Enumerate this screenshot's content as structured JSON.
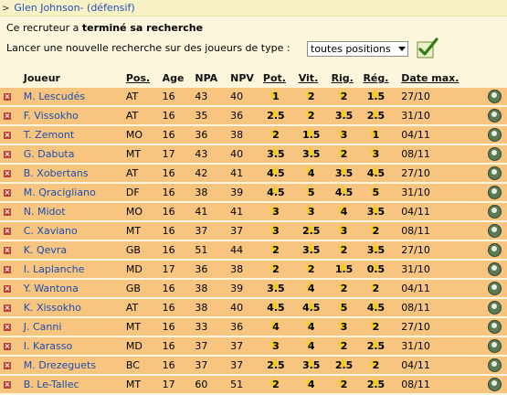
{
  "header": {
    "arrow": ">",
    "title": "Glen Johnson- (défensif)"
  },
  "status": {
    "prefix": "Ce recruteur a ",
    "bold": "terminé sa recherche"
  },
  "search": {
    "label": "Lancer une nouvelle recherche sur des joueurs de type :",
    "selected": "toutes positions"
  },
  "columns": [
    "Joueur",
    "Pos.",
    "Age",
    "NPA",
    "NPV",
    "Pot.",
    "Vit.",
    "Rig.",
    "Rég.",
    "Date max."
  ],
  "players": [
    {
      "name": "M. Lescudés",
      "pos": "AT",
      "age": "16",
      "npa": "43",
      "npv": "40",
      "pot": "1",
      "vit": "2",
      "rig": "2",
      "reg": "1.5",
      "date": "27/10"
    },
    {
      "name": "F. Vissokho",
      "pos": "AT",
      "age": "16",
      "npa": "35",
      "npv": "36",
      "pot": "2.5",
      "vit": "2",
      "rig": "3.5",
      "reg": "2.5",
      "date": "31/10"
    },
    {
      "name": "T. Zemont",
      "pos": "MO",
      "age": "16",
      "npa": "36",
      "npv": "38",
      "pot": "2",
      "vit": "1.5",
      "rig": "3",
      "reg": "1",
      "date": "04/11"
    },
    {
      "name": "G. Dabuta",
      "pos": "MT",
      "age": "17",
      "npa": "43",
      "npv": "40",
      "pot": "3.5",
      "vit": "3.5",
      "rig": "2",
      "reg": "3",
      "date": "08/11"
    },
    {
      "name": "B. Xobertans",
      "pos": "AT",
      "age": "16",
      "npa": "42",
      "npv": "41",
      "pot": "4.5",
      "vit": "4",
      "rig": "3.5",
      "reg": "4.5",
      "date": "27/10"
    },
    {
      "name": "M. Qracigliano",
      "pos": "DF",
      "age": "16",
      "npa": "38",
      "npv": "39",
      "pot": "4.5",
      "vit": "5",
      "rig": "4.5",
      "reg": "5",
      "date": "31/10"
    },
    {
      "name": "N. Midot",
      "pos": "MO",
      "age": "16",
      "npa": "41",
      "npv": "41",
      "pot": "3",
      "vit": "3",
      "rig": "4",
      "reg": "3.5",
      "date": "04/11"
    },
    {
      "name": "C. Xaviano",
      "pos": "MT",
      "age": "16",
      "npa": "37",
      "npv": "37",
      "pot": "3",
      "vit": "2.5",
      "rig": "3",
      "reg": "2",
      "date": "08/11"
    },
    {
      "name": "K. Qevra",
      "pos": "GB",
      "age": "16",
      "npa": "51",
      "npv": "44",
      "pot": "2",
      "vit": "3.5",
      "rig": "2",
      "reg": "3.5",
      "date": "27/10"
    },
    {
      "name": "I. Laplanche",
      "pos": "MD",
      "age": "17",
      "npa": "36",
      "npv": "38",
      "pot": "2",
      "vit": "2",
      "rig": "1.5",
      "reg": "0.5",
      "date": "31/10"
    },
    {
      "name": "Y. Wantona",
      "pos": "GB",
      "age": "16",
      "npa": "38",
      "npv": "39",
      "pot": "3.5",
      "vit": "4",
      "rig": "2",
      "reg": "2",
      "date": "04/11"
    },
    {
      "name": "K. Xissokho",
      "pos": "AT",
      "age": "16",
      "npa": "38",
      "npv": "40",
      "pot": "4.5",
      "vit": "4.5",
      "rig": "5",
      "reg": "4.5",
      "date": "08/11"
    },
    {
      "name": "J. Canni",
      "pos": "MT",
      "age": "16",
      "npa": "33",
      "npv": "36",
      "pot": "4",
      "vit": "4",
      "rig": "3",
      "reg": "2",
      "date": "27/10"
    },
    {
      "name": "I. Karasso",
      "pos": "MD",
      "age": "16",
      "npa": "37",
      "npv": "37",
      "pot": "3",
      "vit": "4",
      "rig": "2",
      "reg": "2.5",
      "date": "31/10"
    },
    {
      "name": "M. Drezeguets",
      "pos": "BC",
      "age": "16",
      "npa": "37",
      "npv": "37",
      "pot": "2.5",
      "vit": "3.5",
      "rig": "2.5",
      "reg": "2",
      "date": "04/11"
    },
    {
      "name": "B. Le-Tallec",
      "pos": "MT",
      "age": "17",
      "npa": "60",
      "npv": "51",
      "pot": "2",
      "vit": "4",
      "rig": "2",
      "reg": "2.5",
      "date": "08/11"
    }
  ],
  "colors": {
    "link": "#1b4db0",
    "row_bg": "#f7c57f",
    "page_bg": "#fcf7dc",
    "star": "#f3cd1e"
  }
}
